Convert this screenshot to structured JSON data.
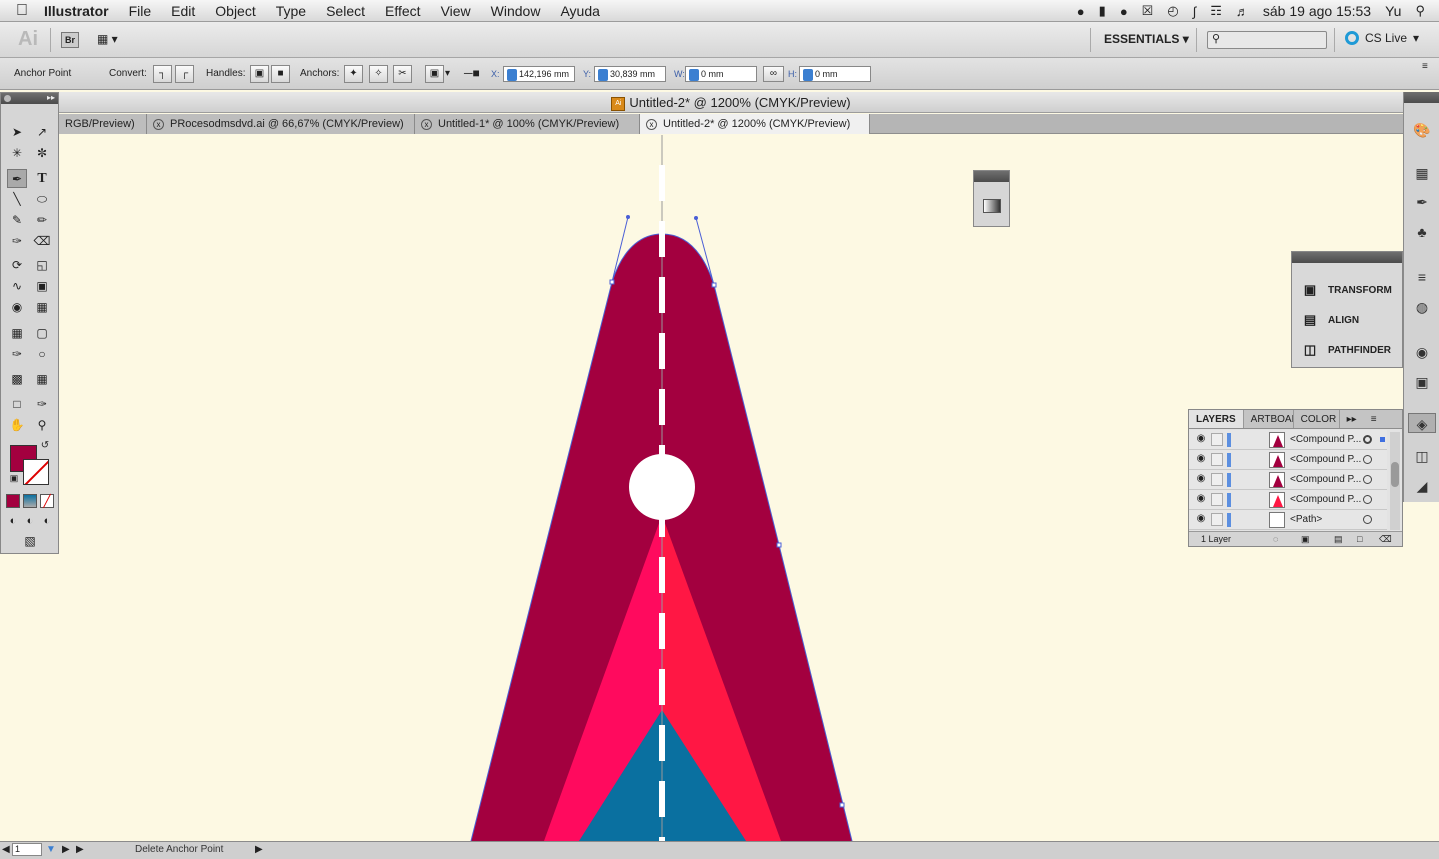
{
  "menubar": {
    "app_name": "Illustrator",
    "menus": [
      "File",
      "Edit",
      "Object",
      "Type",
      "Select",
      "Effect",
      "View",
      "Window",
      "Ayuda"
    ],
    "status": {
      "clock": "sáb 19 ago  15:53",
      "user": "Yu"
    }
  },
  "appbar": {
    "ai_logo": "Ai",
    "bridge": "Br",
    "workspace": "ESSENTIALS",
    "search_placeholder": "",
    "cs_live": "CS Live"
  },
  "control": {
    "tool_label": "Anchor Point",
    "convert_label": "Convert:",
    "handles_label": "Handles:",
    "anchors_label": "Anchors:",
    "x_label": "X:",
    "x_value": "142,196 mm",
    "y_label": "Y:",
    "y_value": "30,839 mm",
    "w_label": "W:",
    "w_value": "0 mm",
    "h_label": "H:",
    "h_value": "0 mm"
  },
  "document": {
    "title": "Untitled-2* @ 1200% (CMYK/Preview)",
    "tabs": [
      {
        "label": "RGB/Preview)"
      },
      {
        "label": "PRocesodmsdvd.ai @ 66,67% (CMYK/Preview)"
      },
      {
        "label": "Untitled-1* @ 100% (CMYK/Preview)"
      },
      {
        "label": "Untitled-2* @ 1200% (CMYK/Preview)"
      }
    ]
  },
  "colors": {
    "canvas": "#fdf9e3",
    "road_dark": "#a3003f",
    "road_pink": "#ff0a5e",
    "road_red": "#ff1744",
    "road_blue": "#0a70a0",
    "selection": "#4a5fd6"
  },
  "panels": {
    "tap": [
      {
        "label": "TRANSFORM",
        "icon": "transform-icon"
      },
      {
        "label": "ALIGN",
        "icon": "align-icon"
      },
      {
        "label": "PATHFINDER",
        "icon": "pathfinder-icon"
      }
    ],
    "layers": {
      "tabs": [
        "LAYERS",
        "ARTBOAR",
        "COLOR G"
      ],
      "rows": [
        {
          "name": "<Compound P..."
        },
        {
          "name": "<Compound P..."
        },
        {
          "name": "<Compound P..."
        },
        {
          "name": "<Compound P..."
        },
        {
          "name": "<Path>"
        }
      ],
      "footer": "1 Layer"
    }
  },
  "statusbar": {
    "zoom": "1",
    "status_text": "Delete Anchor Point"
  }
}
